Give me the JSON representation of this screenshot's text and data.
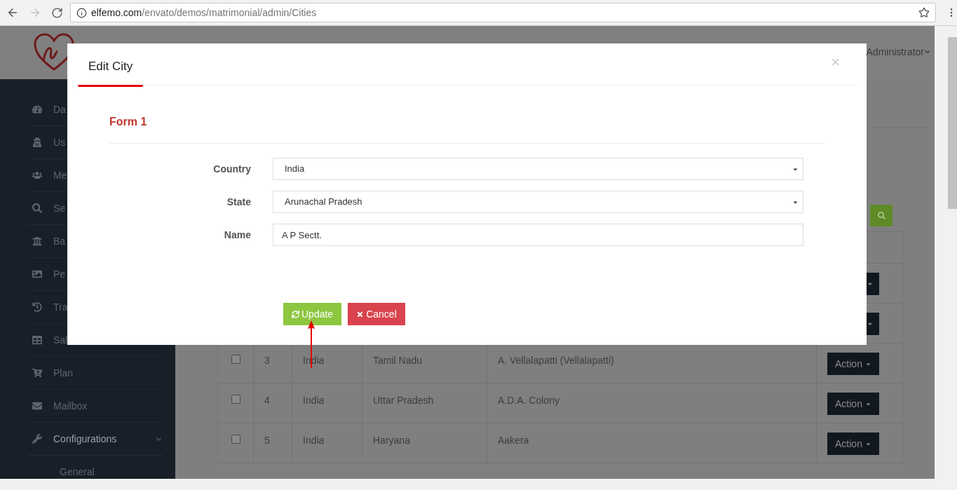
{
  "browser": {
    "url_host": "elfemo.com",
    "url_path": "/envato/demos/matrimonial/admin/Cities"
  },
  "header": {
    "user": "Administrator"
  },
  "sidebar": {
    "items": [
      {
        "label": "Da",
        "expanded": false
      },
      {
        "label": "Us",
        "expanded": false
      },
      {
        "label": "Me",
        "expanded": false
      },
      {
        "label": "Se",
        "expanded": false
      },
      {
        "label": "Ba",
        "expanded": false
      },
      {
        "label": "Pe",
        "expanded": false
      },
      {
        "label": "Tra",
        "expanded": false
      },
      {
        "label": "Sal",
        "expanded": false
      },
      {
        "label": "Plan",
        "expanded": false
      },
      {
        "label": "Mailbox",
        "expanded": false
      },
      {
        "label": "Configurations",
        "expanded": true,
        "children": [
          {
            "label": "General"
          }
        ]
      }
    ]
  },
  "table": {
    "rows": [
      {
        "checked": false,
        "number": "3",
        "country": "India",
        "state": "Tamil Nadu",
        "name": "A. Vellalapatti (Vellalapatti)",
        "action": "Action"
      },
      {
        "checked": false,
        "number": "4",
        "country": "India",
        "state": "Uttar Pradesh",
        "name": "A.D.A. Colony",
        "action": "Action"
      },
      {
        "checked": false,
        "number": "5",
        "country": "India",
        "state": "Haryana",
        "name": "Aakera",
        "action": "Action"
      }
    ]
  },
  "modal": {
    "title": "Edit City",
    "close": "×",
    "section": "Form 1",
    "fields": [
      {
        "kind": "select",
        "label": "Country",
        "value": "India"
      },
      {
        "kind": "select",
        "label": "State",
        "value": "Arunachal Pradesh"
      },
      {
        "kind": "text",
        "label": "Name",
        "value": "A P Sectt."
      }
    ],
    "buttons": [
      {
        "kind": "primary",
        "label": "Update"
      },
      {
        "kind": "danger",
        "label": "Cancel"
      }
    ]
  }
}
